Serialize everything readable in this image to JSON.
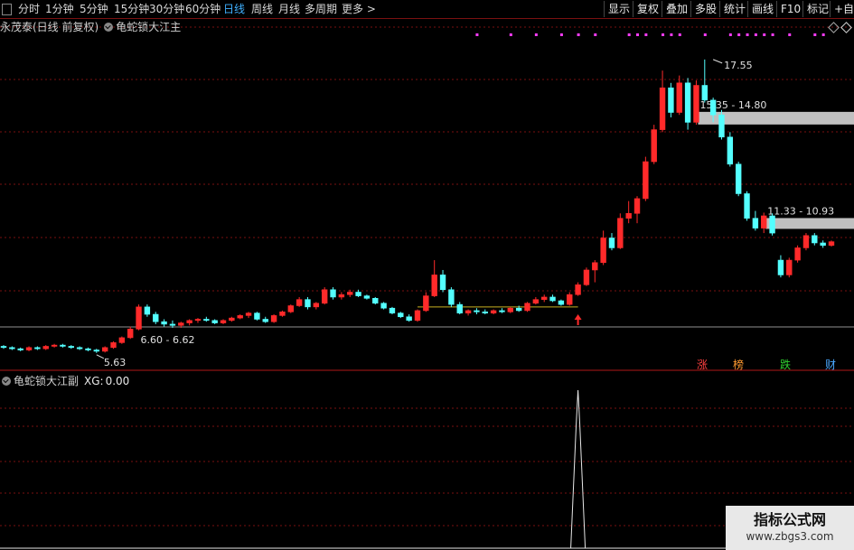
{
  "toolbar": {
    "periods": [
      "分时",
      "1分钟",
      "5分钟",
      "15分钟",
      "30分钟",
      "60分钟",
      "日线",
      "周线",
      "月线",
      "多周期",
      "更多"
    ],
    "active_period": "日线",
    "right_buttons": [
      "显示",
      "复权",
      "叠加",
      "多股",
      "统计",
      "画线",
      "F10",
      "标记",
      "+自选"
    ]
  },
  "main_panel": {
    "stock_label": "永茂泰(日线 前复权)",
    "indicator_name": "龟蛇锁大江主",
    "annotations": {
      "high": "17.55",
      "zone_upper": "15.35 - 14.80",
      "zone_mid": "11.33 - 10.93",
      "zone_low": "6.60 - 6.62",
      "low": "5.63"
    }
  },
  "sub_panel": {
    "indicator_name": "龟蛇锁大江副",
    "xg_label": "XG:",
    "xg_value": "0.00"
  },
  "badges": [
    {
      "text": "涨",
      "color": "#ff4040"
    },
    {
      "text": "榜",
      "color": "#ff9a30"
    },
    {
      "text": "跌",
      "color": "#30d030"
    },
    {
      "text": "财",
      "color": "#4aa8ff"
    }
  ],
  "watermark": {
    "title": "指标公式网",
    "url": "www.zbgs3.com"
  },
  "colors": {
    "up": "#ff2a2a",
    "down": "#54ffff",
    "grid": "#7a1010",
    "marker": "#ff3cff",
    "zone": "#c0c0c0",
    "support_line": "#c8b020"
  },
  "chart_data": {
    "type": "candlestick",
    "price_axis_range": [
      5.0,
      18.5
    ],
    "candles": [
      [
        5.9,
        5.95,
        5.8,
        5.85
      ],
      [
        5.85,
        5.9,
        5.75,
        5.8
      ],
      [
        5.8,
        5.85,
        5.7,
        5.75
      ],
      [
        5.75,
        5.9,
        5.7,
        5.85
      ],
      [
        5.85,
        5.9,
        5.75,
        5.8
      ],
      [
        5.8,
        5.95,
        5.75,
        5.9
      ],
      [
        5.9,
        6.0,
        5.85,
        5.95
      ],
      [
        5.95,
        6.0,
        5.85,
        5.9
      ],
      [
        5.9,
        5.95,
        5.8,
        5.85
      ],
      [
        5.85,
        5.9,
        5.75,
        5.8
      ],
      [
        5.8,
        5.85,
        5.7,
        5.75
      ],
      [
        5.75,
        5.8,
        5.63,
        5.7
      ],
      [
        5.7,
        5.9,
        5.65,
        5.85
      ],
      [
        5.85,
        6.1,
        5.8,
        6.05
      ],
      [
        6.05,
        6.3,
        6.0,
        6.25
      ],
      [
        6.25,
        6.7,
        6.2,
        6.6
      ],
      [
        6.6,
        7.6,
        6.55,
        7.5
      ],
      [
        7.5,
        7.6,
        7.1,
        7.2
      ],
      [
        7.2,
        7.3,
        6.8,
        6.9
      ],
      [
        6.9,
        7.0,
        6.7,
        6.8
      ],
      [
        6.8,
        6.95,
        6.65,
        6.75
      ],
      [
        6.75,
        6.9,
        6.65,
        6.85
      ],
      [
        6.85,
        7.0,
        6.75,
        6.95
      ],
      [
        6.95,
        7.05,
        6.85,
        7.0
      ],
      [
        7.0,
        7.1,
        6.9,
        6.95
      ],
      [
        6.95,
        7.0,
        6.8,
        6.85
      ],
      [
        6.85,
        7.0,
        6.8,
        6.95
      ],
      [
        6.95,
        7.1,
        6.9,
        7.05
      ],
      [
        7.05,
        7.2,
        7.0,
        7.15
      ],
      [
        7.15,
        7.3,
        7.05,
        7.25
      ],
      [
        7.25,
        7.3,
        6.95,
        7.0
      ],
      [
        7.0,
        7.1,
        6.85,
        6.9
      ],
      [
        6.9,
        7.2,
        6.85,
        7.15
      ],
      [
        7.15,
        7.35,
        7.1,
        7.3
      ],
      [
        7.3,
        7.6,
        7.25,
        7.55
      ],
      [
        7.55,
        7.9,
        7.5,
        7.8
      ],
      [
        7.8,
        7.9,
        7.4,
        7.5
      ],
      [
        7.5,
        7.7,
        7.4,
        7.65
      ],
      [
        7.65,
        8.3,
        7.6,
        8.2
      ],
      [
        8.2,
        8.3,
        7.8,
        7.9
      ],
      [
        7.9,
        8.1,
        7.8,
        8.0
      ],
      [
        8.0,
        8.2,
        7.9,
        8.1
      ],
      [
        8.1,
        8.2,
        7.9,
        7.95
      ],
      [
        7.95,
        8.0,
        7.8,
        7.85
      ],
      [
        7.85,
        7.9,
        7.6,
        7.65
      ],
      [
        7.65,
        7.7,
        7.4,
        7.45
      ],
      [
        7.45,
        7.5,
        7.2,
        7.25
      ],
      [
        7.25,
        7.3,
        7.05,
        7.1
      ],
      [
        7.1,
        7.2,
        6.9,
        6.95
      ],
      [
        6.95,
        7.4,
        6.9,
        7.35
      ],
      [
        7.35,
        8.1,
        7.3,
        7.95
      ],
      [
        7.95,
        9.4,
        7.9,
        8.8
      ],
      [
        8.8,
        9.0,
        8.1,
        8.2
      ],
      [
        8.2,
        8.3,
        7.5,
        7.6
      ],
      [
        7.6,
        7.7,
        7.2,
        7.25
      ],
      [
        7.25,
        7.4,
        7.15,
        7.35
      ],
      [
        7.35,
        7.45,
        7.2,
        7.3
      ],
      [
        7.3,
        7.4,
        7.2,
        7.25
      ],
      [
        7.25,
        7.4,
        7.2,
        7.35
      ],
      [
        7.35,
        7.45,
        7.25,
        7.3
      ],
      [
        7.3,
        7.5,
        7.25,
        7.45
      ],
      [
        7.45,
        7.55,
        7.3,
        7.35
      ],
      [
        7.35,
        7.7,
        7.3,
        7.65
      ],
      [
        7.65,
        7.9,
        7.6,
        7.8
      ],
      [
        7.8,
        8.0,
        7.7,
        7.9
      ],
      [
        7.9,
        8.0,
        7.7,
        7.75
      ],
      [
        7.75,
        7.8,
        7.55,
        7.6
      ],
      [
        7.6,
        8.1,
        7.55,
        8.0
      ],
      [
        8.0,
        8.5,
        7.95,
        8.4
      ],
      [
        8.4,
        9.1,
        8.35,
        9.0
      ],
      [
        9.0,
        9.4,
        8.5,
        9.3
      ],
      [
        9.3,
        10.6,
        9.2,
        10.3
      ],
      [
        10.3,
        10.5,
        9.8,
        9.9
      ],
      [
        9.9,
        11.3,
        9.85,
        11.1
      ],
      [
        11.1,
        11.8,
        10.9,
        11.3
      ],
      [
        11.3,
        12.0,
        10.9,
        11.9
      ],
      [
        11.9,
        13.6,
        11.8,
        13.4
      ],
      [
        13.4,
        14.9,
        13.3,
        14.7
      ],
      [
        14.7,
        17.1,
        14.6,
        16.4
      ],
      [
        16.4,
        16.6,
        15.2,
        15.4
      ],
      [
        15.4,
        16.9,
        15.3,
        16.6
      ],
      [
        16.6,
        16.8,
        14.7,
        15.0
      ],
      [
        15.0,
        16.7,
        14.9,
        16.5
      ],
      [
        16.5,
        17.55,
        15.8,
        15.9
      ],
      [
        15.9,
        16.0,
        15.0,
        15.3
      ],
      [
        15.3,
        15.5,
        14.3,
        14.4
      ],
      [
        14.4,
        14.6,
        13.2,
        13.3
      ],
      [
        13.3,
        13.4,
        12.0,
        12.1
      ],
      [
        12.1,
        12.2,
        11.0,
        11.1
      ],
      [
        11.1,
        11.4,
        10.6,
        10.7
      ],
      [
        10.7,
        11.33,
        10.5,
        11.2
      ],
      [
        11.2,
        11.3,
        10.4,
        10.5
      ],
      [
        9.4,
        9.6,
        8.7,
        8.8
      ],
      [
        8.8,
        9.5,
        8.7,
        9.4
      ],
      [
        9.4,
        10.0,
        9.3,
        9.9
      ],
      [
        9.9,
        10.5,
        9.8,
        10.4
      ],
      [
        10.4,
        10.5,
        10.0,
        10.1
      ],
      [
        10.1,
        10.2,
        9.9,
        10.0
      ],
      [
        10.0,
        10.2,
        9.95,
        10.15
      ]
    ]
  }
}
